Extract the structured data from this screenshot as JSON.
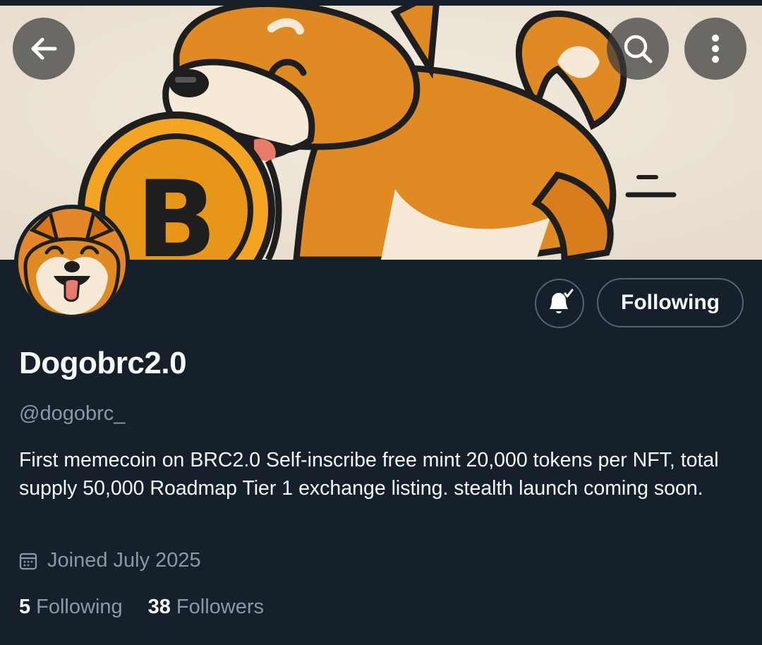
{
  "header": {
    "back_icon": "arrow-left-icon",
    "search_icon": "search-icon",
    "more_icon": "more-vertical-icon"
  },
  "banner": {
    "image": "shiba-dog-with-bitcoin-coin",
    "coin_symbol": "B"
  },
  "profile": {
    "display_name": "Dogobrc2.0",
    "handle": "@dogobrc_",
    "bio": "First memecoin on BRC2.0 Self-inscribe free mint 20,000 tokens per NFT, total supply 50,000 Roadmap Tier 1 exchange listing. stealth launch coming soon.",
    "joined": "Joined July 2025"
  },
  "actions": {
    "notifications_icon": "bell-check-icon",
    "follow_label": "Following"
  },
  "stats": {
    "following_count": "5",
    "following_label": "Following",
    "followers_count": "38",
    "followers_label": "Followers"
  },
  "colors": {
    "background": "#15202b",
    "text_primary": "#f7f9f9",
    "text_secondary": "#8b98a5",
    "border": "#536471",
    "brand_orange": "#e08a24"
  }
}
